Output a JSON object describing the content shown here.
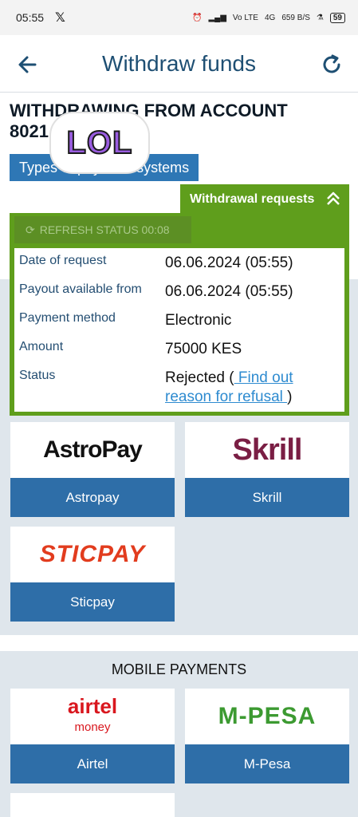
{
  "status_bar": {
    "time": "05:55",
    "battery": "59",
    "net_speed": "659 B/S",
    "network": "4G",
    "volte": "Vo LTE"
  },
  "header": {
    "title": "Withdraw funds"
  },
  "account": {
    "line1": "WITHDRAWING FROM ACCOUNT",
    "line2": "8021"
  },
  "sticker": {
    "text": "LOL"
  },
  "tabs": {
    "types": "Types of payment systems"
  },
  "withdrawal": {
    "header": "Withdrawal requests",
    "refresh_label": "REFRESH STATUS 00:08",
    "rows": [
      {
        "label": "Date of request",
        "value": "06.06.2024 (05:55)"
      },
      {
        "label": "Payout available from",
        "value": "06.06.2024 (05:55)"
      },
      {
        "label": "Payment method",
        "value": "Electronic"
      },
      {
        "label": "Amount",
        "value": "75000 KES"
      },
      {
        "label": "Status",
        "value_prefix": "Rejected (",
        "link": " Find out reason for refusal ",
        "value_suffix": ")"
      }
    ]
  },
  "systems": [
    {
      "logo": "AstroPay",
      "label": "Astropay"
    },
    {
      "logo": "Skrill",
      "label": "Skrill"
    },
    {
      "logo": "STICPAY",
      "label": "Sticpay"
    }
  ],
  "mobile": {
    "title": "MOBILE PAYMENTS",
    "items": [
      {
        "logo_main": "airtel",
        "logo_sub": "money",
        "label": "Airtel"
      },
      {
        "logo": "M-PESA",
        "label": "M-Pesa"
      }
    ]
  },
  "colors": {
    "brand_blue": "#2e6ea8",
    "green": "#5f9e1c",
    "title_blue": "#1e4f73"
  }
}
